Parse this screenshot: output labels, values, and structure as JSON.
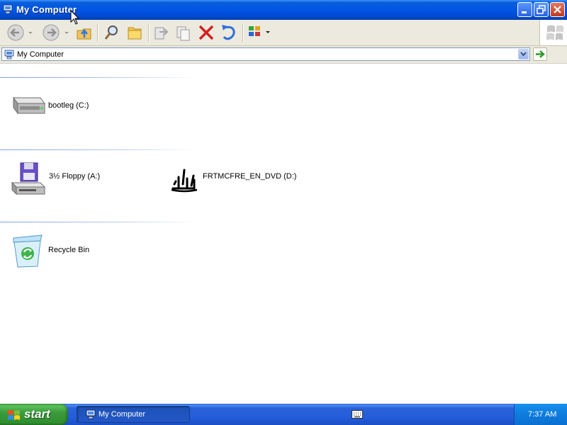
{
  "window": {
    "title": "My Computer",
    "title_icon": "my-computer-icon",
    "controls": [
      "minimize-icon",
      "restore-icon",
      "close-icon"
    ]
  },
  "toolbar": {
    "buttons": [
      "back-icon",
      "forward-icon",
      "up-folder-icon",
      "search-icon",
      "folders-icon",
      "move-to-icon",
      "copy-to-icon",
      "delete-icon",
      "undo-icon",
      "views-icon"
    ]
  },
  "address": {
    "value": "My Computer",
    "icon": "my-computer-icon"
  },
  "groups": [
    {
      "items": [
        {
          "label": "bootleg (C:)",
          "icon": "hard-drive-icon"
        }
      ]
    },
    {
      "items": [
        {
          "label": "3½ Floppy (A:)",
          "icon": "floppy-drive-icon"
        },
        {
          "label": "FRTMCFRE_EN_DVD (D:)",
          "icon": "dvd-drive-icon"
        }
      ]
    },
    {
      "items": [
        {
          "label": "Recycle Bin",
          "icon": "recycle-bin-icon"
        }
      ]
    }
  ],
  "taskbar": {
    "start_label": "start",
    "task": "My Computer",
    "clock": "7:37 AM"
  },
  "colors": {
    "titlebar": "#0055e5",
    "taskbar": "#245edb",
    "start_button": "#3c9b3c",
    "tray": "#0f7fe0"
  }
}
